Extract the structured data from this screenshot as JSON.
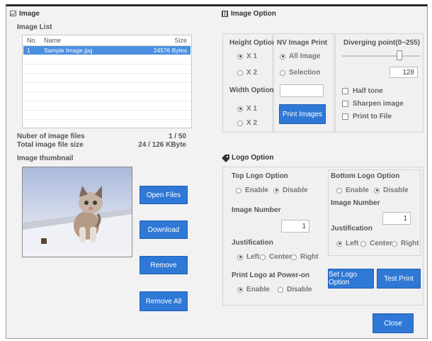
{
  "image_panel": {
    "title": "Image",
    "list_title": "Image List",
    "columns": [
      "No.",
      "Name",
      "Size"
    ],
    "rows": [
      {
        "no": "1",
        "name": "Sample Image.jpg",
        "size": "24576 Bytes"
      }
    ],
    "num_files_label": "Nuber of image files",
    "num_files_value": "1 / 50",
    "total_size_label": "Total image file size",
    "total_size_value": "24 / 126 KByte",
    "thumbnail_label": "Image thumbnail",
    "buttons": {
      "open": "Open Files",
      "download": "Download",
      "remove": "Remove",
      "remove_all": "Remove All"
    }
  },
  "image_option": {
    "title": "Image Option",
    "height_option": {
      "title": "Height Option",
      "x1": "X 1",
      "x2": "X 2",
      "selected": "X 1"
    },
    "width_option": {
      "title": "Width Option",
      "x1": "X 1",
      "x2": "X 2",
      "selected": "X 1"
    },
    "nv_print": {
      "title": "NV Image Print",
      "all": "All Image",
      "selection": "Selection",
      "selected": "All Image",
      "print_button": "Print Images"
    },
    "diverging": {
      "title": "Diverging point(0~255)",
      "value": "128",
      "level": 0.5
    },
    "checks": {
      "half_tone": "Half tone",
      "sharpen": "Sharpen image",
      "print_to_file": "Print to File"
    }
  },
  "logo_option": {
    "title": "Logo Option",
    "top": {
      "title": "Top Logo Option",
      "enable": "Enable",
      "disable": "Disable",
      "selected": "Disable",
      "image_number_label": "Image Number",
      "image_number": "1",
      "justification_label": "Justification",
      "left": "Left",
      "center": "Center",
      "right": "Right",
      "just_selected": "Left",
      "power_on_label": "Print Logo at Power-on",
      "power_enable": "Enable",
      "power_disable": "Disable",
      "power_selected": "Enable"
    },
    "bottom": {
      "title": "Bottom Logo Option",
      "enable": "Enable",
      "disable": "Disable",
      "selected": "Disable",
      "image_number_label": "Image Number",
      "image_number": "1",
      "justification_label": "Justification",
      "left": "Left",
      "center": "Center",
      "right": "Right",
      "just_selected": "Left"
    },
    "set_button": "Set Logo Option",
    "test_button": "Test Print"
  },
  "close_button": "Close",
  "colors": {
    "accent": "#2f78d6",
    "selection": "#4a8fe0"
  }
}
